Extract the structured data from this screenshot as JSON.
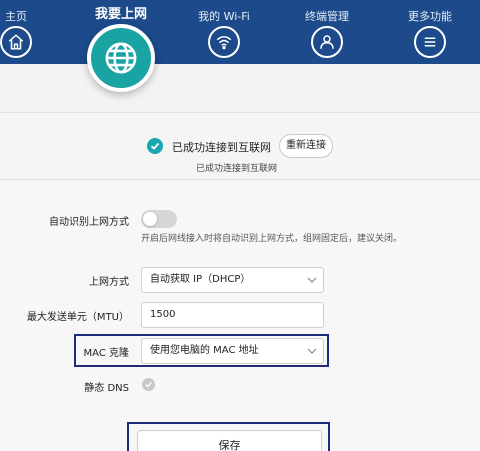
{
  "nav": {
    "home": {
      "label": "主页",
      "icon": "home-icon"
    },
    "internet": {
      "label": "我要上网",
      "icon": "globe-icon",
      "active": true
    },
    "wifi": {
      "label": "我的 Wi-Fi",
      "icon": "wifi-icon"
    },
    "devices": {
      "label": "终端管理",
      "icon": "user-icon"
    },
    "more": {
      "label": "更多功能",
      "icon": "menu-icon"
    }
  },
  "status": {
    "message": "已成功连接到互联网",
    "reconnect_label": "重新连接",
    "sub_message": "已成功连接到互联网"
  },
  "form": {
    "auto_detect": {
      "label": "自动识别上网方式",
      "enabled": false,
      "hint": "开启后网线接入时将自动识别上网方式，组网固定后，建议关闭。"
    },
    "wan_mode": {
      "label": "上网方式",
      "value": "自动获取 IP（DHCP）"
    },
    "mtu": {
      "label": "最大发送单元（MTU）",
      "value": "1500"
    },
    "mac_clone": {
      "label": "MAC 克隆",
      "value": "使用您电脑的 MAC 地址"
    },
    "static_dns": {
      "label": "静态 DNS",
      "checked": true
    },
    "save_label": "保存"
  },
  "colors": {
    "nav_bg": "#1c4a8a",
    "accent": "#1aa7b0",
    "highlight_frame": "#1f2a7a"
  }
}
